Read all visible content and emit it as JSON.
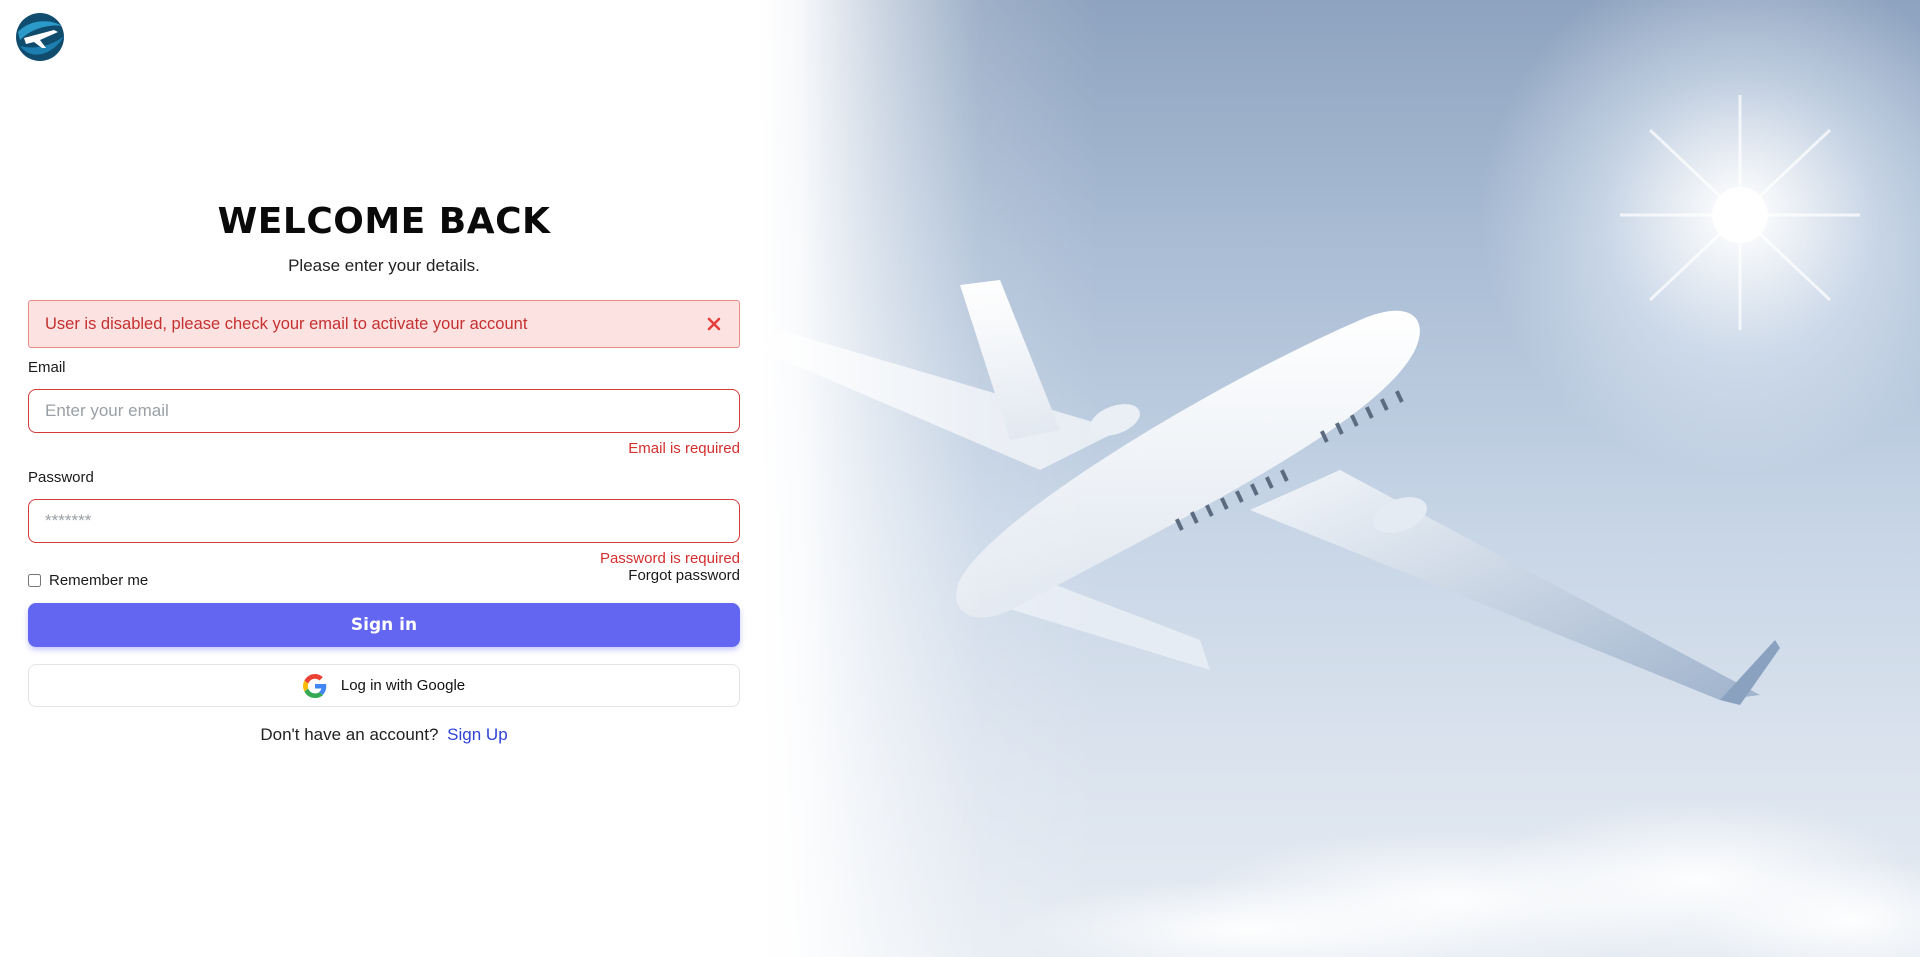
{
  "header": {
    "logo_icon": "airplane-globe-logo"
  },
  "form": {
    "title": "WELCOME BACK",
    "subtitle": "Please enter your details.",
    "alert": {
      "message": "User is disabled, please check your email to activate your account",
      "close_icon": "close-icon"
    },
    "email": {
      "label": "Email",
      "placeholder": "Enter your email",
      "value": "",
      "error": "Email is required"
    },
    "password": {
      "label": "Password",
      "placeholder": "*******",
      "value": "",
      "error": "Password is required"
    },
    "remember_label": "Remember me",
    "remember_checked": false,
    "forgot_label": "Forgot password",
    "signin_label": "Sign in",
    "google_label": "Log in with Google",
    "signup_prompt": "Don't have an account?",
    "signup_label": "Sign Up"
  },
  "colors": {
    "primary": "#6366f1",
    "error": "#d32f2f",
    "alert_bg": "#fde2e2",
    "link": "#2f43d6"
  }
}
